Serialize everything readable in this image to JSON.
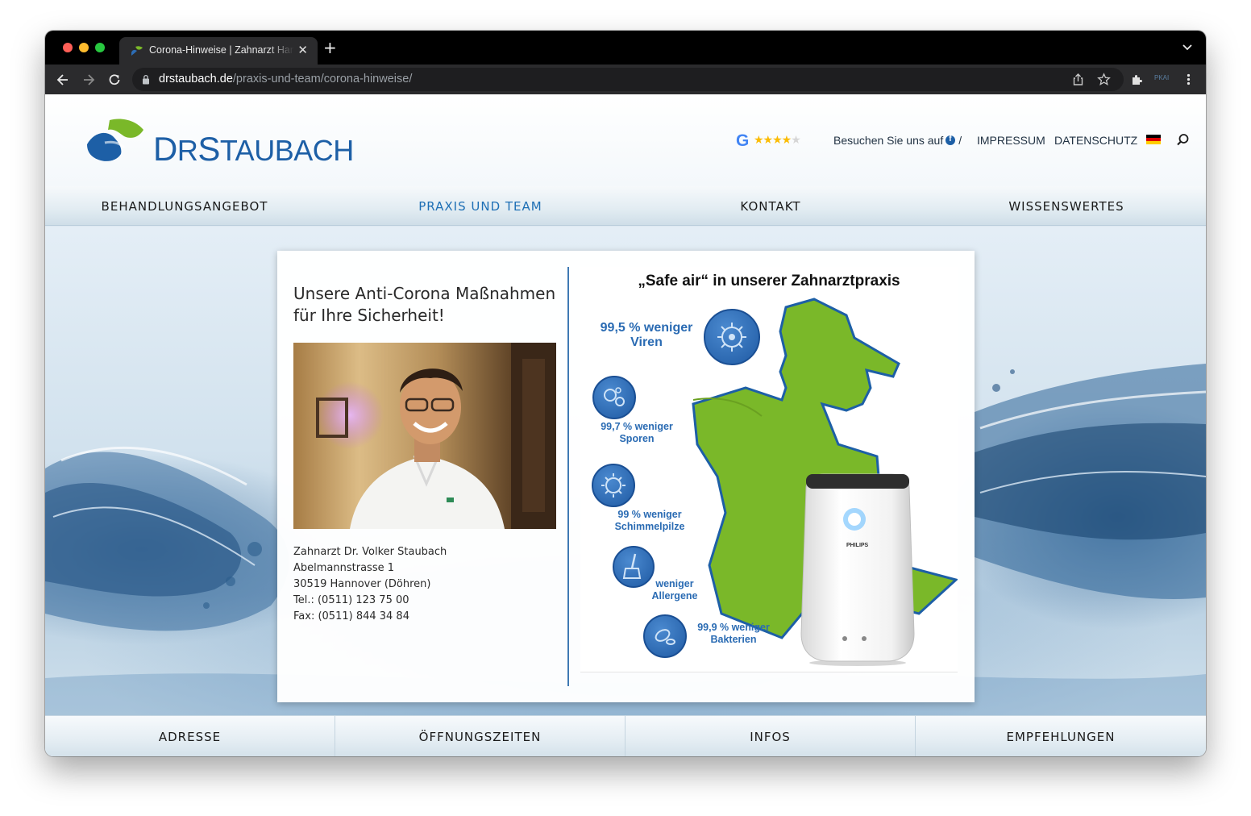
{
  "browser": {
    "tab_title": "Corona-Hinweise | Zahnarzt Hannover",
    "tab_close": "✕",
    "new_tab": "+",
    "url_host": "drstaubach.de",
    "url_path": "/praxis-und-team/corona-hinweise/",
    "extension_label": "PKAI"
  },
  "header": {
    "logo_first": "D",
    "logo_rest": "R",
    "logo_s": "S",
    "logo_tail": "TAUBACH",
    "google_letter": "G",
    "stars_filled": "★★★★",
    "stars_empty": "★",
    "facebook_text": "Besuchen Sie uns auf",
    "facebook_slash": "/",
    "impressum": "IMPRESSUM",
    "datenschutz": "DATENSCHUTZ"
  },
  "mainnav": [
    {
      "label": "BEHANDLUNGSANGEBOT"
    },
    {
      "label": "PRAXIS UND TEAM"
    },
    {
      "label": "KONTAKT"
    },
    {
      "label": "WISSENSWERTES"
    }
  ],
  "card": {
    "heading_line1": "Unsere Anti-Corona Maßnahmen",
    "heading_line2": "für Ihre Sicherheit!",
    "address": [
      "Zahnarzt Dr. Volker Staubach",
      "Abelmannstrasse 1",
      "30519 Hannover (Döhren)",
      "Tel.: (0511) 123 75 00",
      "Fax: (0511) 844 34 84"
    ]
  },
  "infographic": {
    "title": "„Safe air“ in unserer Zahnarztpraxis",
    "badges": [
      {
        "line1": "99,5 % weniger",
        "line2": "Viren",
        "icon": "virus-icon"
      },
      {
        "line1": "99,7 % weniger",
        "line2": "Sporen",
        "icon": "spores-icon"
      },
      {
        "line1": "99 % weniger",
        "line2": "Schimmelpilze",
        "icon": "mold-icon"
      },
      {
        "line1": "weniger",
        "line2": "Allergene",
        "icon": "broom-icon"
      },
      {
        "line1": "99,9 % weniger",
        "line2": "Bakterien",
        "icon": "bacteria-icon"
      }
    ],
    "purifier_brand": "PHILIPS"
  },
  "footernav": [
    {
      "label": "ADRESSE"
    },
    {
      "label": "ÖFFNUNGSZEITEN"
    },
    {
      "label": "INFOS"
    },
    {
      "label": "EMPFEHLUNGEN"
    }
  ],
  "colors": {
    "brand_blue": "#1d5fa6",
    "brand_green": "#7ab829",
    "nav_active": "#1e6fb5"
  }
}
